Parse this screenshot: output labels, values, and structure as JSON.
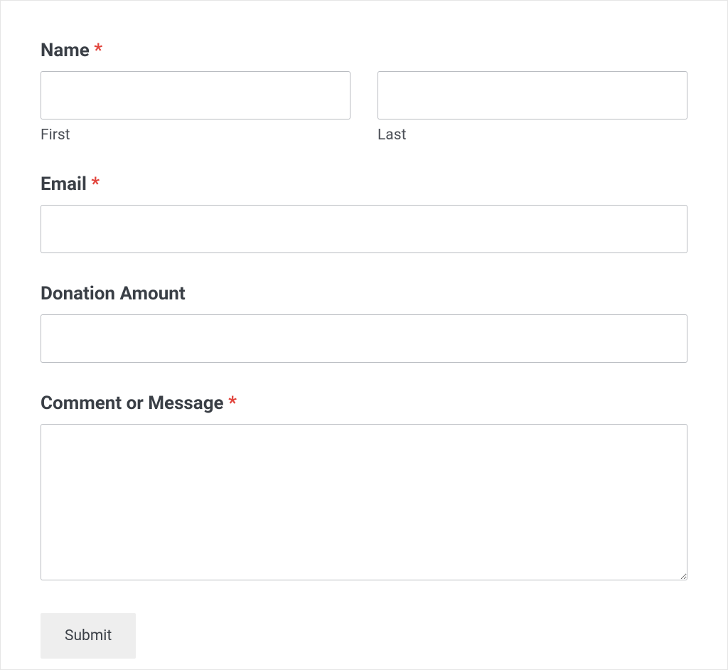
{
  "form": {
    "name": {
      "label": "Name",
      "required_marker": "*",
      "first_sublabel": "First",
      "last_sublabel": "Last",
      "first_value": "",
      "last_value": ""
    },
    "email": {
      "label": "Email",
      "required_marker": "*",
      "value": ""
    },
    "donation": {
      "label": "Donation Amount",
      "value": ""
    },
    "comment": {
      "label": "Comment or Message",
      "required_marker": "*",
      "value": ""
    },
    "submit": {
      "label": "Submit"
    }
  }
}
